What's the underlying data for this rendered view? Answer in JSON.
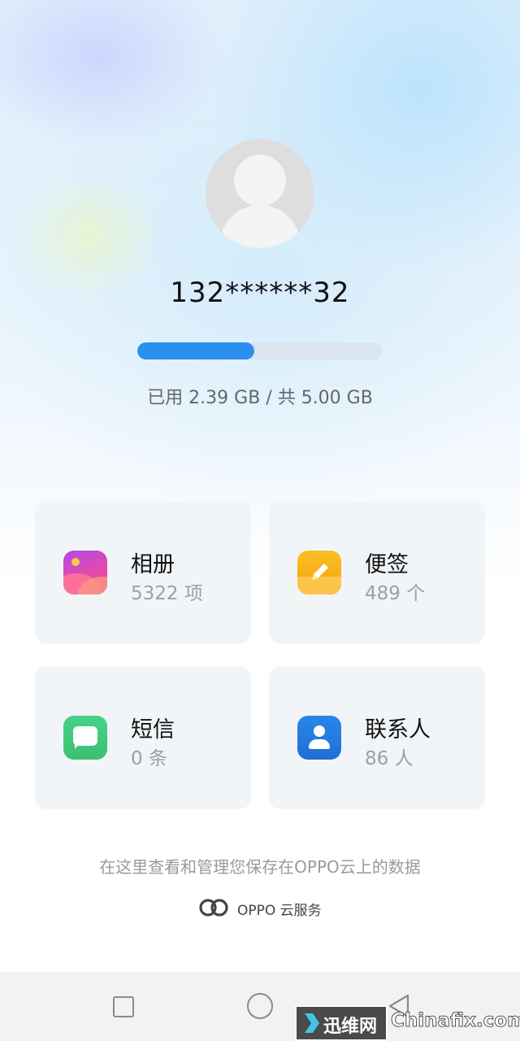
{
  "profile": {
    "username": "132******32"
  },
  "storage": {
    "used_fraction": 0.478,
    "text": "已用 2.39 GB / 共 5.00 GB"
  },
  "cards": [
    {
      "title": "相册",
      "count": "5322 项",
      "icon": "photo-album-icon"
    },
    {
      "title": "便签",
      "count": "489 个",
      "icon": "notes-pencil-icon"
    },
    {
      "title": "短信",
      "count": "0 条",
      "icon": "sms-bubble-icon"
    },
    {
      "title": "联系人",
      "count": "86 人",
      "icon": "contact-person-icon"
    }
  ],
  "footer": {
    "description": "在这里查看和管理您保存在OPPO云上的数据",
    "brand": "OPPO 云服务"
  },
  "navbar": {
    "icons": [
      "recents-square-icon",
      "home-circle-icon",
      "back-triangle-icon"
    ]
  },
  "watermark": {
    "left": "迅维网",
    "right": "Chinafix.com"
  },
  "colors": {
    "accent": "#2b8ff0",
    "card_bg": "#f2f5f8",
    "text_primary": "#111111",
    "text_secondary": "#9aa0a6"
  }
}
